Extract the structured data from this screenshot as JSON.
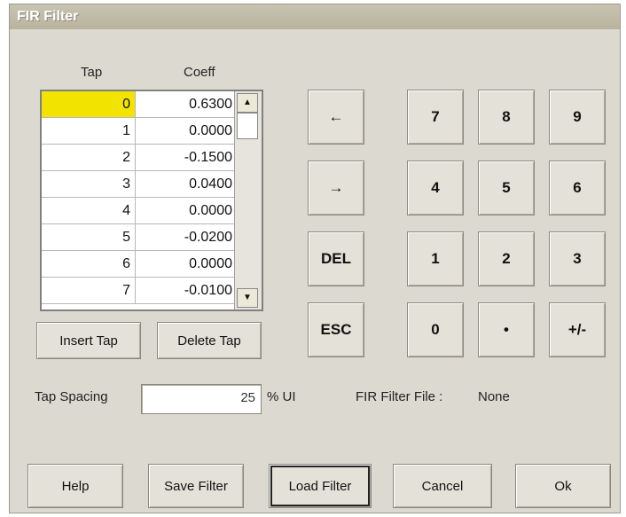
{
  "window": {
    "title": "FIR Filter"
  },
  "table": {
    "headers": {
      "tap": "Tap",
      "coeff": "Coeff"
    },
    "rows": [
      {
        "tap": "0",
        "coeff": "0.6300"
      },
      {
        "tap": "1",
        "coeff": "0.0000"
      },
      {
        "tap": "2",
        "coeff": "-0.1500"
      },
      {
        "tap": "3",
        "coeff": "0.0400"
      },
      {
        "tap": "4",
        "coeff": "0.0000"
      },
      {
        "tap": "5",
        "coeff": "-0.0200"
      },
      {
        "tap": "6",
        "coeff": "0.0000"
      },
      {
        "tap": "7",
        "coeff": "-0.0100"
      }
    ],
    "selected_row": 0,
    "selected_color": "#f2e400",
    "scroll_up": "▲",
    "scroll_down": "▼"
  },
  "table_buttons": {
    "insert": "Insert Tap",
    "delete": "Delete Tap"
  },
  "keypad": {
    "left": "←",
    "right": "→",
    "del": "DEL",
    "esc": "ESC",
    "k7": "7",
    "k8": "8",
    "k9": "9",
    "k4": "4",
    "k5": "5",
    "k6": "6",
    "k1": "1",
    "k2": "2",
    "k3": "3",
    "k0": "0",
    "dot": "•",
    "plusminus": "+/-"
  },
  "tap_spacing": {
    "label": "Tap Spacing",
    "value": "25",
    "unit": "% UI"
  },
  "fir_file": {
    "label": "FIR Filter File :",
    "value": "None"
  },
  "footer": {
    "help": "Help",
    "save": "Save Filter",
    "load": "Load Filter",
    "cancel": "Cancel",
    "ok": "Ok"
  }
}
